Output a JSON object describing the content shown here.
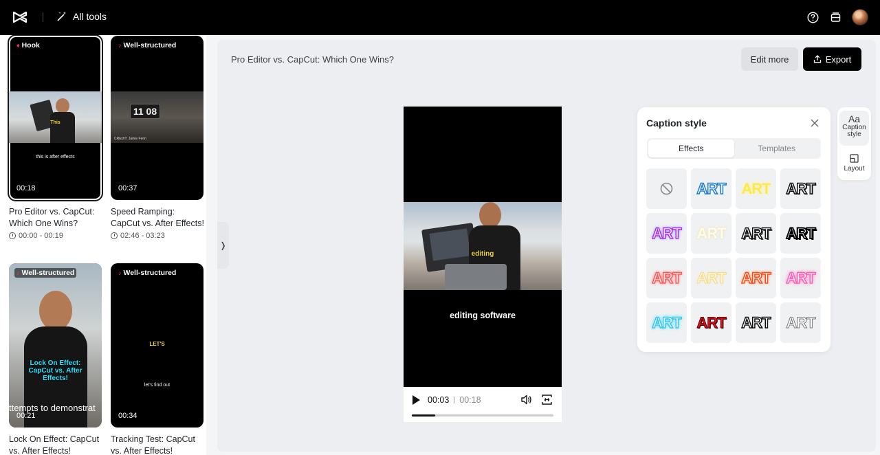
{
  "topbar": {
    "all_tools_label": "All tools",
    "icons": [
      "capcut-logo-icon",
      "magic-wand-icon",
      "help-icon",
      "storage-icon",
      "avatar"
    ]
  },
  "videos": [
    {
      "tag": "Hook",
      "duration": "00:18",
      "title": "Pro Editor vs. CapCut: Which One Wins?",
      "time_range": "00:00 - 00:19",
      "caption_word": "This",
      "caption_sub": "this is after effects",
      "selected": true
    },
    {
      "tag": "Well-structured",
      "duration": "00:37",
      "title": "Speed Ramping: CapCut vs. After Effects!",
      "time_range": "02:46 - 03:23",
      "clock_text": "11 08",
      "credit": "CREDIT: Jamie Fenn"
    },
    {
      "tag": "Well-structured",
      "duration": "00:21",
      "title": "Lock On Effect: CapCut vs. After Effects!",
      "overlay": "Lock On Effect: CapCut vs. After Effects!",
      "ticker": "ttempts to demonstrat"
    },
    {
      "tag": "Well-structured",
      "duration": "00:34",
      "title": "Tracking Test: CapCut vs. After Effects!",
      "caption_word": "LET'S",
      "caption_sub": "let's find out"
    }
  ],
  "editor": {
    "project_title": "Pro Editor vs. CapCut: Which One Wins?",
    "edit_more_label": "Edit more",
    "export_label": "Export"
  },
  "player": {
    "caption_word": "editing",
    "subtitle": "editing software",
    "current_time": "00:03",
    "total_time": "00:18",
    "progress": 0.167
  },
  "caption_panel": {
    "title": "Caption style",
    "tabs": [
      {
        "label": "Effects",
        "active": true
      },
      {
        "label": "Templates",
        "active": false
      }
    ],
    "preset_text": "ART"
  },
  "rail": {
    "items": [
      {
        "icon": "Aa",
        "label": "Caption style",
        "active": true
      },
      {
        "label": "Layout",
        "active": false
      }
    ]
  }
}
